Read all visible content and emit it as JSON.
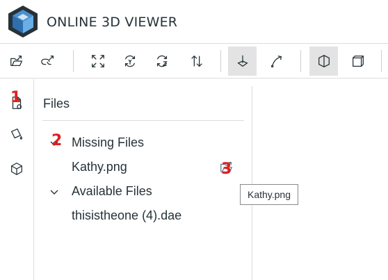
{
  "header": {
    "title": "ONLINE 3D VIEWER",
    "logo_icon": "cube-logo-icon"
  },
  "toolbar": {
    "buttons": [
      {
        "name": "open-file-button",
        "icon": "folder-open-icon",
        "selected": false
      },
      {
        "name": "open-url-button",
        "icon": "link-icon",
        "selected": false
      },
      {
        "name": "fit-to-window-button",
        "icon": "fit-window-icon",
        "selected": false
      },
      {
        "name": "set-up-y-button",
        "icon": "rotate-y-icon",
        "selected": false
      },
      {
        "name": "set-up-z-button",
        "icon": "rotate-z-icon",
        "selected": false
      },
      {
        "name": "flip-up-button",
        "icon": "flip-icon",
        "selected": false
      },
      {
        "name": "fixed-up-vector-button",
        "icon": "fixed-up-icon",
        "selected": true
      },
      {
        "name": "free-orbit-button",
        "icon": "free-orbit-icon",
        "selected": false
      },
      {
        "name": "perspective-camera-button",
        "icon": "perspective-icon",
        "selected": true
      },
      {
        "name": "orthographic-camera-button",
        "icon": "orthographic-icon",
        "selected": false
      }
    ]
  },
  "leftnav": {
    "items": [
      {
        "name": "nav-files",
        "icon": "files-icon"
      },
      {
        "name": "nav-materials",
        "icon": "materials-icon"
      },
      {
        "name": "nav-meshes",
        "icon": "meshes-icon"
      }
    ]
  },
  "panel": {
    "title": "Files",
    "missing_group": {
      "label": "Missing Files",
      "items": [
        "Kathy.png"
      ]
    },
    "available_group": {
      "label": "Available Files",
      "items": [
        "thisistheone (4).dae"
      ]
    }
  },
  "tooltip": {
    "text": "Kathy.png"
  },
  "markers": [
    "1",
    "2",
    "3"
  ],
  "colors": {
    "accent": "#263238",
    "logo_blue": "#3c80c3",
    "marker_red": "#e02020",
    "selected_bg": "#e3e3e3"
  }
}
